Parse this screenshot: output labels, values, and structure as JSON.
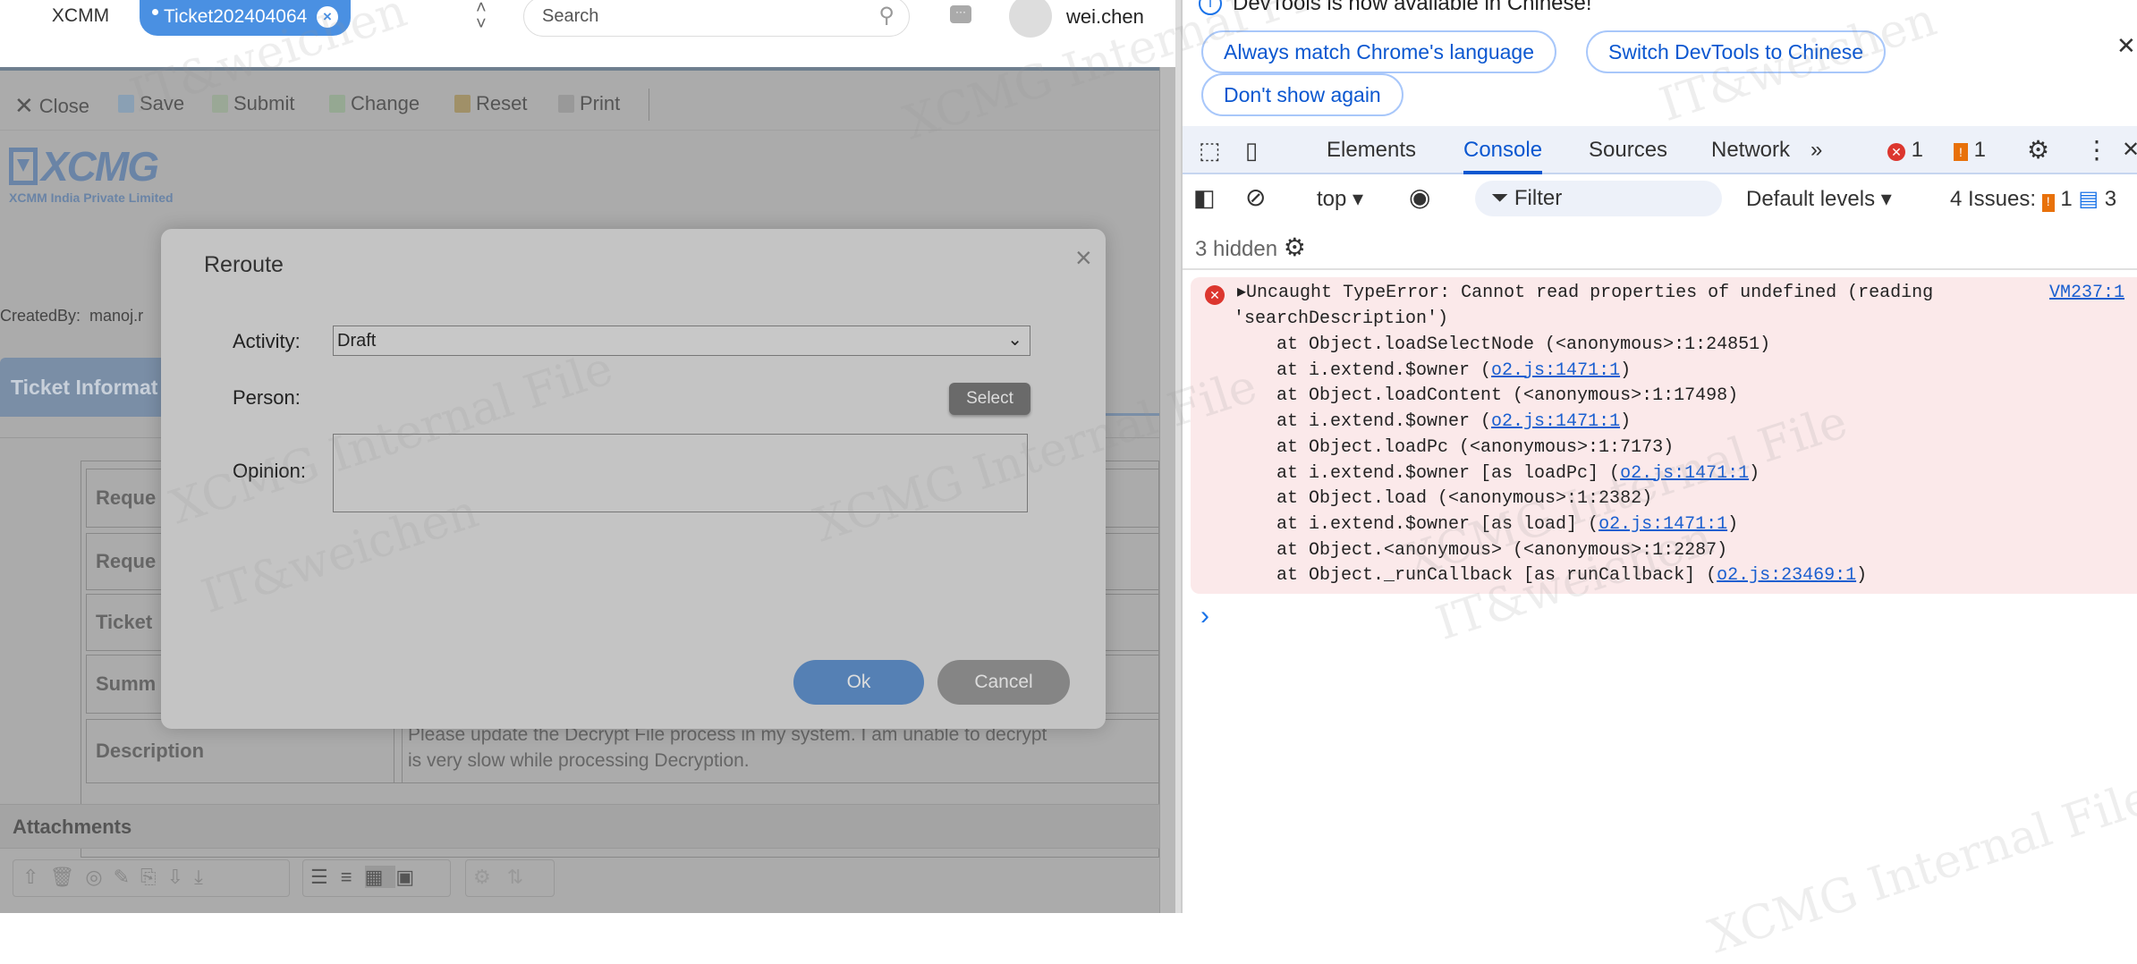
{
  "app_tabs": {
    "home": "XCMM",
    "active": "Ticket202404064"
  },
  "search": {
    "placeholder": "Search"
  },
  "user": {
    "name": "wei.chen"
  },
  "toolbar": {
    "close": "Close",
    "save": "Save",
    "submit": "Submit",
    "change": "Change",
    "reset": "Reset",
    "print": "Print"
  },
  "logo": {
    "brand": "XCMG",
    "company": "XCMM India Private Limited"
  },
  "created_by": "CreatedBy:  manoj.r",
  "ticket_tab": "Ticket Informat",
  "table": {
    "rows": [
      {
        "label": "Reque",
        "value": ""
      },
      {
        "label": "Reque",
        "value": ""
      },
      {
        "label": "Ticket",
        "value": ""
      },
      {
        "label": "Summ",
        "value": ""
      },
      {
        "label": "Description",
        "value": "Please update the Decrypt File process in my system. I am unable to decrypt\nis very slow while processing Decryption."
      }
    ]
  },
  "attachments": {
    "title": "Attachments"
  },
  "modal": {
    "title": "Reroute",
    "close": "×",
    "activity_label": "Activity:",
    "activity_value": "Draft",
    "person_label": "Person:",
    "select_btn": "Select",
    "opinion_label": "Opinion:",
    "opinion_value": "",
    "ok": "Ok",
    "cancel": "Cancel"
  },
  "devtools": {
    "info": "DevTools is now available in Chinese!",
    "btn_match": "Always match Chrome's language",
    "btn_switch": "Switch DevTools to Chinese",
    "btn_dont": "Don't show again",
    "tabs": [
      "Elements",
      "Console",
      "Sources",
      "Network"
    ],
    "error_count": "1",
    "warn_count": "1",
    "context": "top",
    "filter_placeholder": "Filter",
    "levels": "Default levels",
    "issues_label": "4 Issues:",
    "issues_warn": "1",
    "issues_info": "3",
    "hidden": "3 hidden",
    "error": {
      "message": "Uncaught TypeError: Cannot read properties of undefined (reading",
      "message2": "'searchDescription')",
      "source": "VM237:1",
      "stack": [
        {
          "text": "at Object.loadSelectNode (<anonymous>:1:24851)",
          "link": ""
        },
        {
          "text": "at i.extend.$owner (",
          "link": "o2.js:1471:1",
          "tail": ")"
        },
        {
          "text": "at Object.loadContent (<anonymous>:1:17498)",
          "link": ""
        },
        {
          "text": "at i.extend.$owner (",
          "link": "o2.js:1471:1",
          "tail": ")"
        },
        {
          "text": "at Object.loadPc (<anonymous>:1:7173)",
          "link": ""
        },
        {
          "text": "at i.extend.$owner [as loadPc] (",
          "link": "o2.js:1471:1",
          "tail": ")"
        },
        {
          "text": "at Object.load (<anonymous>:1:2382)",
          "link": ""
        },
        {
          "text": "at i.extend.$owner [as load] (",
          "link": "o2.js:1471:1",
          "tail": ")"
        },
        {
          "text": "at Object.<anonymous> (<anonymous>:1:2287)",
          "link": ""
        },
        {
          "text": "at Object._runCallback [as runCallback] (",
          "link": "o2.js:23469:1",
          "tail": ")"
        }
      ]
    },
    "prompt": "›"
  },
  "watermarks": [
    "IT&weichen",
    "XCMG Internal File"
  ]
}
